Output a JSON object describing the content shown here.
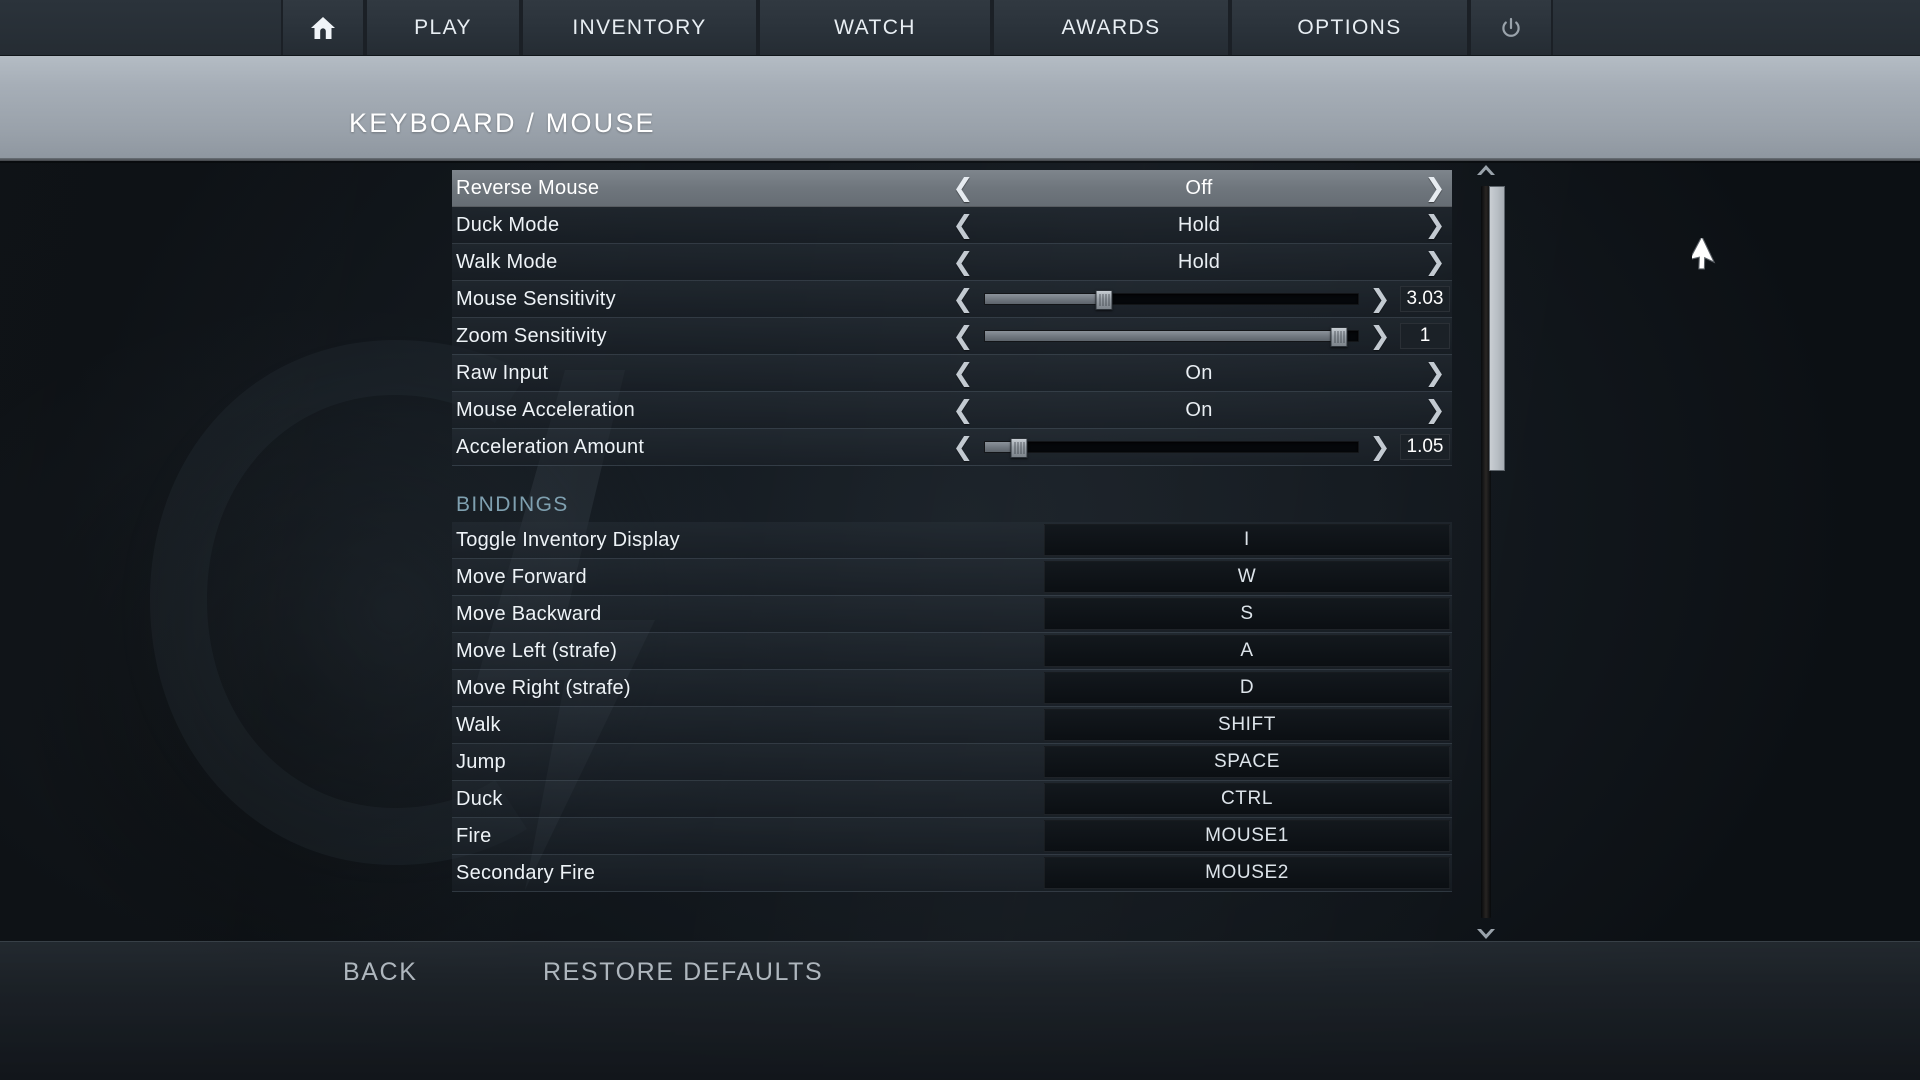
{
  "nav": {
    "home_icon": "home-icon",
    "power_icon": "power-icon",
    "tabs": [
      {
        "id": "play",
        "label": "PLAY"
      },
      {
        "id": "inventory",
        "label": "INVENTORY"
      },
      {
        "id": "watch",
        "label": "WATCH"
      },
      {
        "id": "awards",
        "label": "AWARDS"
      },
      {
        "id": "options",
        "label": "OPTIONS"
      }
    ]
  },
  "header": {
    "title": "KEYBOARD / MOUSE"
  },
  "settings": [
    {
      "label": "Reverse Mouse",
      "type": "cycle",
      "value": "Off",
      "selected": true
    },
    {
      "label": "Duck Mode",
      "type": "cycle",
      "value": "Hold",
      "selected": false
    },
    {
      "label": "Walk Mode",
      "type": "cycle",
      "value": "Hold",
      "selected": false
    },
    {
      "label": "Mouse Sensitivity",
      "type": "slider",
      "value": "3.03",
      "percent": 32,
      "selected": false
    },
    {
      "label": "Zoom Sensitivity",
      "type": "slider",
      "value": "1",
      "percent": 95,
      "selected": false
    },
    {
      "label": "Raw Input",
      "type": "cycle",
      "value": "On",
      "selected": false
    },
    {
      "label": "Mouse Acceleration",
      "type": "cycle",
      "value": "On",
      "selected": false
    },
    {
      "label": "Acceleration Amount",
      "type": "slider",
      "value": "1.05",
      "percent": 9,
      "selected": false
    }
  ],
  "bindings_section": {
    "title": "BINDINGS",
    "rows": [
      {
        "label": "Toggle Inventory Display",
        "key": "I"
      },
      {
        "label": "Move Forward",
        "key": "W"
      },
      {
        "label": "Move Backward",
        "key": "S"
      },
      {
        "label": "Move Left (strafe)",
        "key": "A"
      },
      {
        "label": "Move Right (strafe)",
        "key": "D"
      },
      {
        "label": "Walk",
        "key": "SHIFT"
      },
      {
        "label": "Jump",
        "key": "SPACE"
      },
      {
        "label": "Duck",
        "key": "CTRL"
      },
      {
        "label": "Fire",
        "key": "MOUSE1"
      },
      {
        "label": "Secondary Fire",
        "key": "MOUSE2"
      }
    ]
  },
  "scrollbar": {
    "up_arrow": "▲",
    "down_arrow": "▼",
    "thumb_top_pct": 0,
    "thumb_height_pct": 39
  },
  "footer": {
    "back_label": "BACK",
    "restore_label": "RESTORE DEFAULTS"
  },
  "chevrons": {
    "left": "❮",
    "right": "❯"
  },
  "colors": {
    "nav_bg": "#2c343c",
    "header_band": "#9aa2ab",
    "selected_row": "#757c83",
    "section_title": "#7fa0b0",
    "text": "#eef3f7",
    "footer_text": "#aeb6bd"
  }
}
